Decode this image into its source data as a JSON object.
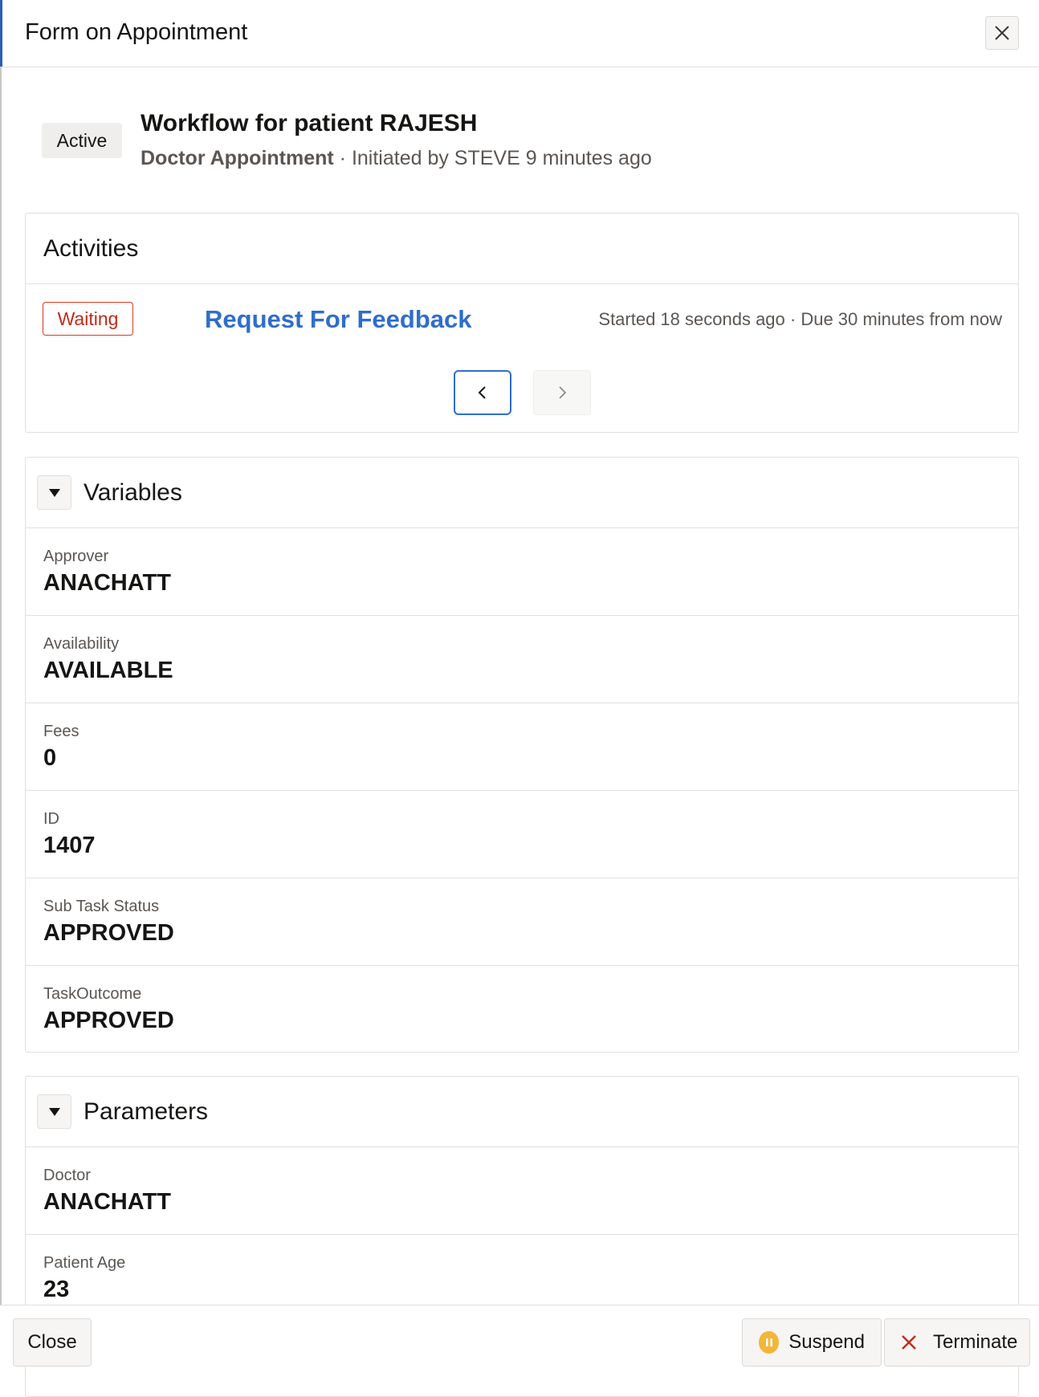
{
  "dialog": {
    "title": "Form on Appointment",
    "close_icon": "close-icon"
  },
  "summary": {
    "status": "Active",
    "title": "Workflow for patient RAJESH",
    "definition": "Doctor Appointment",
    "initiated": "· Initiated by STEVE 9 minutes ago"
  },
  "activities": {
    "title": "Activities",
    "items": [
      {
        "status": "Waiting",
        "name": "Request For Feedback",
        "meta": "Started 18 seconds ago · Due 30 minutes from now"
      }
    ],
    "pager": {
      "prev_icon": "chevron-left-icon",
      "next_icon": "chevron-right-icon"
    }
  },
  "variables": {
    "title": "Variables",
    "rows": [
      {
        "label": "Approver",
        "value": "ANACHATT"
      },
      {
        "label": "Availability",
        "value": "AVAILABLE"
      },
      {
        "label": "Fees",
        "value": "0"
      },
      {
        "label": "ID",
        "value": "1407"
      },
      {
        "label": "Sub Task Status",
        "value": "APPROVED"
      },
      {
        "label": "TaskOutcome",
        "value": "APPROVED"
      }
    ]
  },
  "parameters": {
    "title": "Parameters",
    "rows": [
      {
        "label": "Doctor",
        "value": "ANACHATT"
      },
      {
        "label": "Patient Age",
        "value": "23"
      }
    ]
  },
  "footer": {
    "close_label": "Close",
    "suspend_label": "Suspend",
    "terminate_label": "Terminate"
  },
  "colors": {
    "accent": "#2e6ecb",
    "waiting": "#c32a17",
    "suspend": "#f3b637",
    "terminate": "#c32a17"
  }
}
